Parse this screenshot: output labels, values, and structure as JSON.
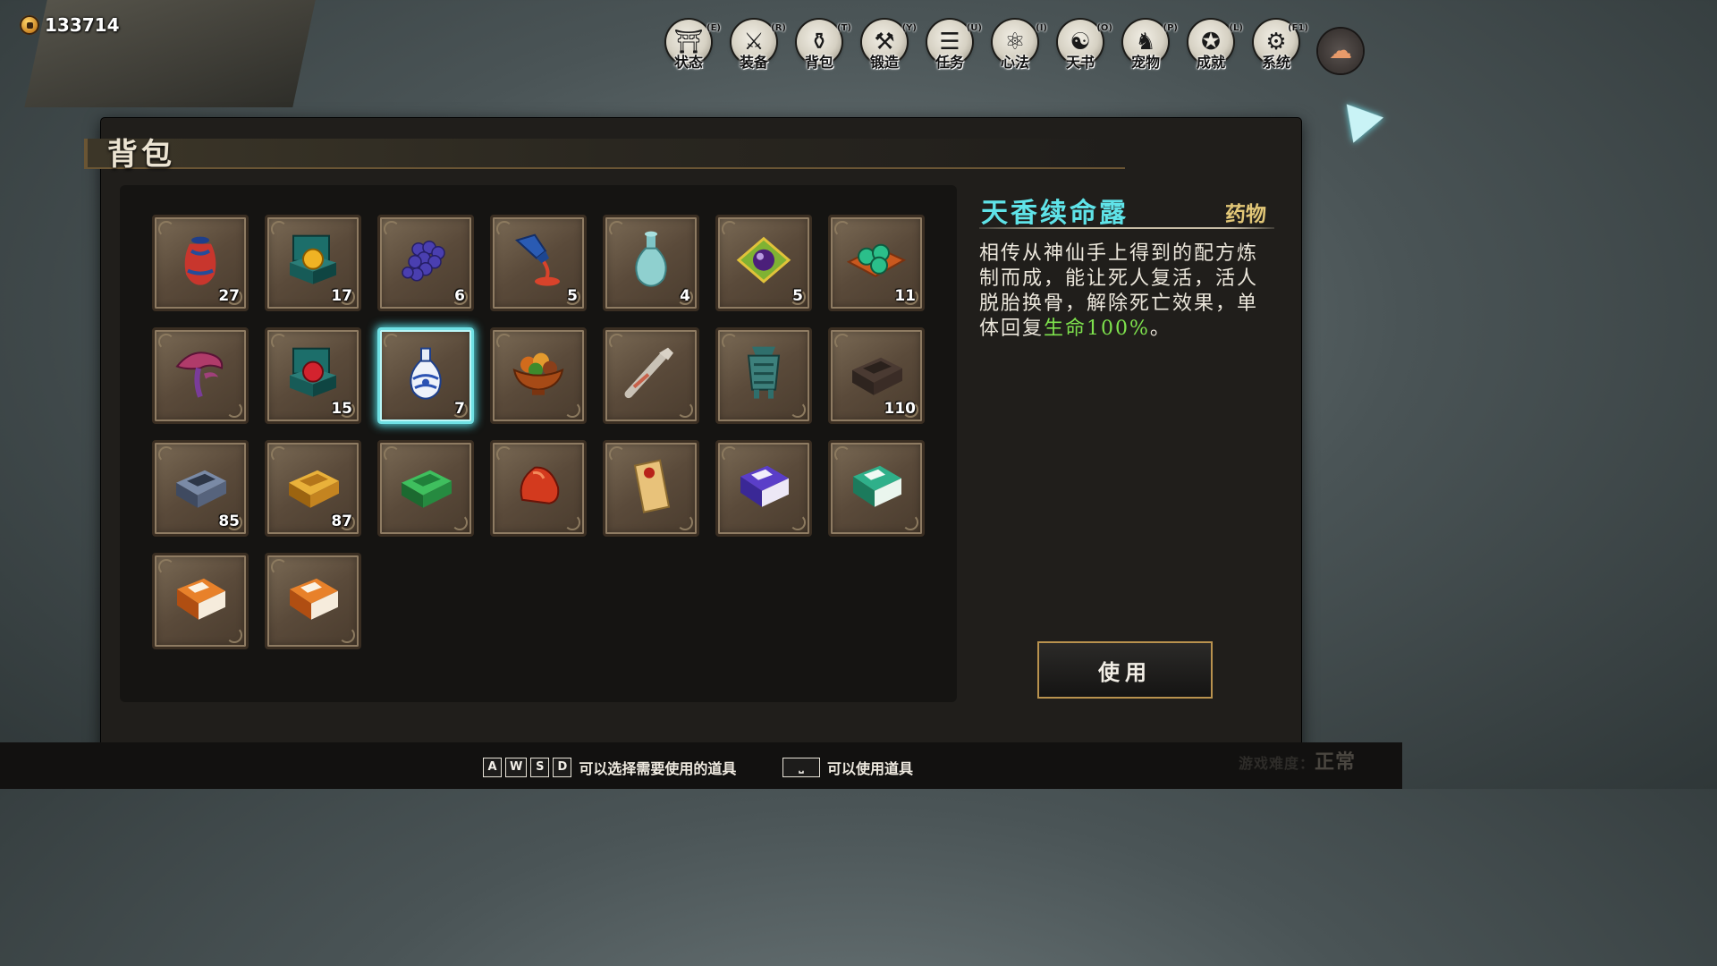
{
  "currency": {
    "icon": "coin-icon",
    "amount": "133714"
  },
  "menu": [
    {
      "name": "status",
      "label": "状态",
      "key": "(E)",
      "icon": "hat-icon",
      "glyph": "⛩"
    },
    {
      "name": "equipment",
      "label": "装备",
      "key": "(R)",
      "icon": "swords-icon",
      "glyph": "⚔"
    },
    {
      "name": "bag",
      "label": "背包",
      "key": "(T)",
      "icon": "bag-icon",
      "glyph": "⚱"
    },
    {
      "name": "forge",
      "label": "锻造",
      "key": "(Y)",
      "icon": "hammer-icon",
      "glyph": "⚒"
    },
    {
      "name": "quest",
      "label": "任务",
      "key": "(U)",
      "icon": "scroll-icon",
      "glyph": "☰"
    },
    {
      "name": "mind",
      "label": "心法",
      "key": "(I)",
      "icon": "skill-tree-icon",
      "glyph": "⚛"
    },
    {
      "name": "tianshu",
      "label": "天书",
      "key": "(O)",
      "icon": "taiji-icon",
      "glyph": "☯"
    },
    {
      "name": "pet",
      "label": "宠物",
      "key": "(P)",
      "icon": "fox-icon",
      "glyph": "♞"
    },
    {
      "name": "achievement",
      "label": "成就",
      "key": "(L)",
      "icon": "medal-icon",
      "glyph": "✪"
    },
    {
      "name": "system",
      "label": "系统",
      "key": "(F1)",
      "icon": "gear-icon",
      "glyph": "⚙"
    }
  ],
  "extra_button": {
    "icon": "cloud-icon",
    "glyph": "☁"
  },
  "panel": {
    "title": "背包"
  },
  "items": [
    {
      "name": "jar",
      "icon": "wine-jar-icon",
      "qty": "27"
    },
    {
      "name": "gold-orb-box",
      "icon": "gold-orb-box-icon",
      "qty": "17"
    },
    {
      "name": "grapes",
      "icon": "grapes-icon",
      "qty": "6"
    },
    {
      "name": "pouring-vase",
      "icon": "pouring-vase-icon",
      "qty": "5"
    },
    {
      "name": "jade-vase",
      "icon": "jade-vase-icon",
      "qty": "4"
    },
    {
      "name": "spirit-pearl",
      "icon": "spirit-pearl-icon",
      "qty": "5"
    },
    {
      "name": "green-pills",
      "icon": "green-pills-icon",
      "qty": "11"
    },
    {
      "name": "lingzhi",
      "icon": "lingzhi-mushroom-icon",
      "qty": ""
    },
    {
      "name": "red-orb-box",
      "icon": "red-orb-box-icon",
      "qty": "15"
    },
    {
      "name": "porcelain-vase",
      "icon": "porcelain-vase-icon",
      "qty": "7",
      "selected": true
    },
    {
      "name": "fruit-bowl",
      "icon": "fruit-bowl-icon",
      "qty": ""
    },
    {
      "name": "arm-relic",
      "icon": "arm-relic-icon",
      "qty": ""
    },
    {
      "name": "bronze-vessel",
      "icon": "bronze-vessel-icon",
      "qty": ""
    },
    {
      "name": "dark-ingot",
      "icon": "dark-ingot-icon",
      "qty": "110"
    },
    {
      "name": "iron-ingot",
      "icon": "iron-ingot-icon",
      "qty": "85"
    },
    {
      "name": "gold-ingot",
      "icon": "gold-ingot-icon",
      "qty": "87"
    },
    {
      "name": "jade-ingot",
      "icon": "jade-ingot-icon",
      "qty": ""
    },
    {
      "name": "red-crystal",
      "icon": "red-crystal-icon",
      "qty": ""
    },
    {
      "name": "sealed-letter",
      "icon": "sealed-letter-icon",
      "qty": ""
    },
    {
      "name": "purple-book",
      "icon": "purple-book-icon",
      "qty": ""
    },
    {
      "name": "green-book",
      "icon": "green-book-icon",
      "qty": ""
    },
    {
      "name": "orange-book-1",
      "icon": "orange-book-icon",
      "qty": ""
    },
    {
      "name": "orange-book-2",
      "icon": "orange-book-icon",
      "qty": ""
    }
  ],
  "detail": {
    "name": "天香续命露",
    "type": "药物",
    "desc_main": "相传从神仙手上得到的配方炼制而成，能让死人复活，活人脱胎换骨，解除死亡效果，单体回复",
    "desc_highlight": "生命100%",
    "desc_end": "。"
  },
  "use_button": "使用",
  "hints": {
    "keys": [
      "A",
      "W",
      "S",
      "D"
    ],
    "select_text": "可以选择需要使用的道具",
    "space_key": "⎵",
    "use_text": "可以使用道具"
  },
  "corner": {
    "faded": "游戏难度：",
    "value": "正常"
  },
  "colors": {
    "selected_glow": "#6fe0e4",
    "item_name": "#5fe3e8",
    "item_type": "#e2c777",
    "highlight": "#7ee24d",
    "button_border": "#b9924e"
  }
}
